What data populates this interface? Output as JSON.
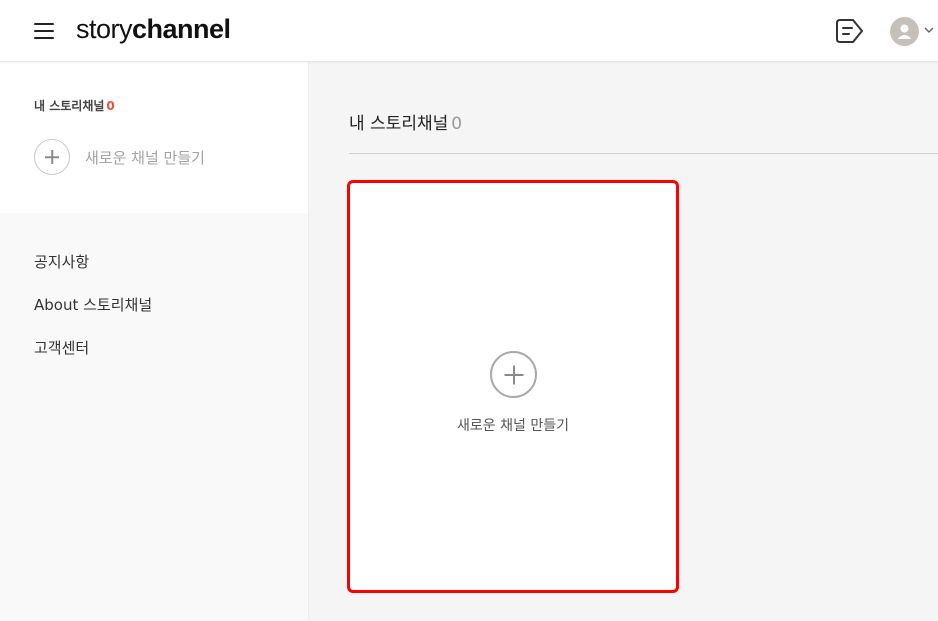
{
  "header": {
    "logo_light": "story",
    "logo_bold": "channel"
  },
  "sidebar": {
    "my_channels_label": "내 스토리채널",
    "my_channels_count": "0",
    "create_label": "새로운 채널 만들기",
    "links": [
      {
        "label": "공지사항"
      },
      {
        "label": "About 스토리채널"
      },
      {
        "label": "고객센터"
      }
    ]
  },
  "main": {
    "title": "내 스토리채널",
    "count": "0",
    "create_card_label": "새로운 채널 만들기"
  },
  "colors": {
    "accent_count": "#e8542f",
    "highlight_border": "#ff0000",
    "avatar_bg": "#c5c0ba"
  },
  "icons": [
    "menu-icon",
    "tag-icon",
    "user-avatar-icon",
    "chevron-down-icon",
    "plus-circle-icon"
  ]
}
